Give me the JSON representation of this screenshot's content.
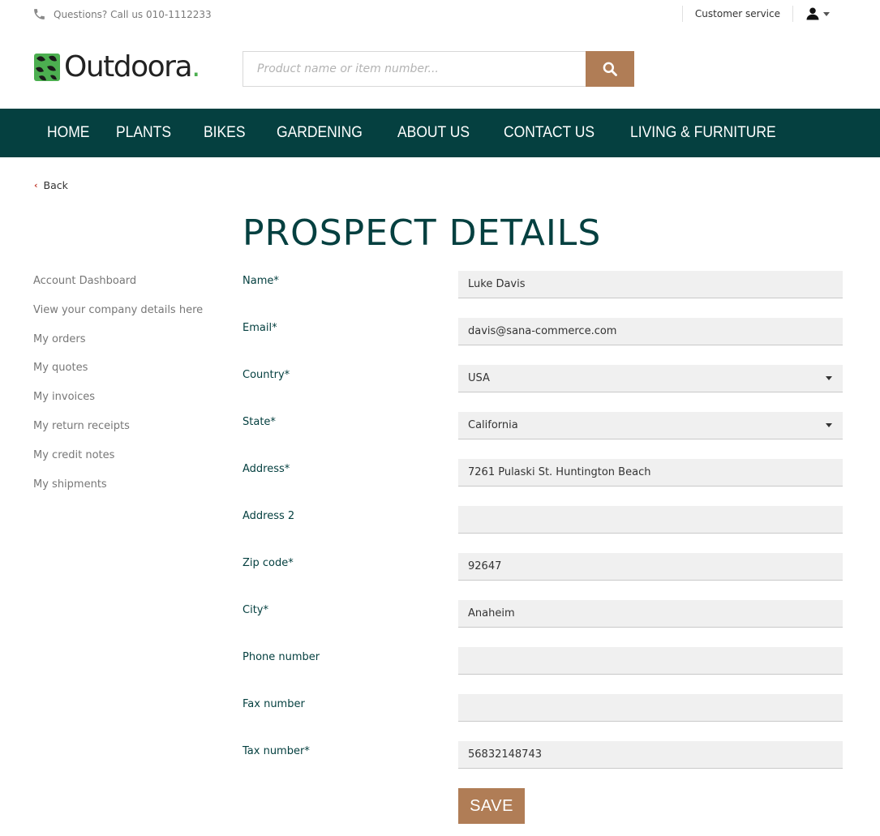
{
  "topbar": {
    "phone_text": "Questions? Call us 010-1112233",
    "customer_service": "Customer service"
  },
  "brand": {
    "name": "Outdoora",
    "dot": ".",
    "accent_color": "#4caf50",
    "primary_color": "#054040",
    "button_color": "#b07d56"
  },
  "search": {
    "placeholder": "Product name or item number..."
  },
  "nav": {
    "items": [
      "HOME",
      "PLANTS",
      "BIKES",
      "GARDENING",
      "ABOUT US",
      "CONTACT US",
      "LIVING & FURNITURE"
    ]
  },
  "back_label": "Back",
  "page_title": "PROSPECT DETAILS",
  "sidebar": {
    "items": [
      "Account Dashboard",
      "View your company details here",
      "My orders",
      "My quotes",
      "My invoices",
      "My return receipts",
      "My credit notes",
      "My shipments"
    ]
  },
  "form": {
    "fields": [
      {
        "label": "Name*",
        "value": "Luke Davis",
        "type": "text"
      },
      {
        "label": "Email*",
        "value": "davis@sana-commerce.com",
        "type": "text"
      },
      {
        "label": "Country*",
        "value": "USA",
        "type": "select"
      },
      {
        "label": "State*",
        "value": "California",
        "type": "select"
      },
      {
        "label": "Address*",
        "value": "7261 Pulaski St. Huntington Beach",
        "type": "text"
      },
      {
        "label": "Address 2",
        "value": "",
        "type": "text"
      },
      {
        "label": "Zip code*",
        "value": "92647",
        "type": "text"
      },
      {
        "label": "City*",
        "value": "Anaheim",
        "type": "text"
      },
      {
        "label": "Phone number",
        "value": "",
        "type": "text"
      },
      {
        "label": "Fax number",
        "value": "",
        "type": "text"
      },
      {
        "label": "Tax number*",
        "value": "56832148743",
        "type": "text"
      }
    ],
    "save_label": "SAVE"
  }
}
